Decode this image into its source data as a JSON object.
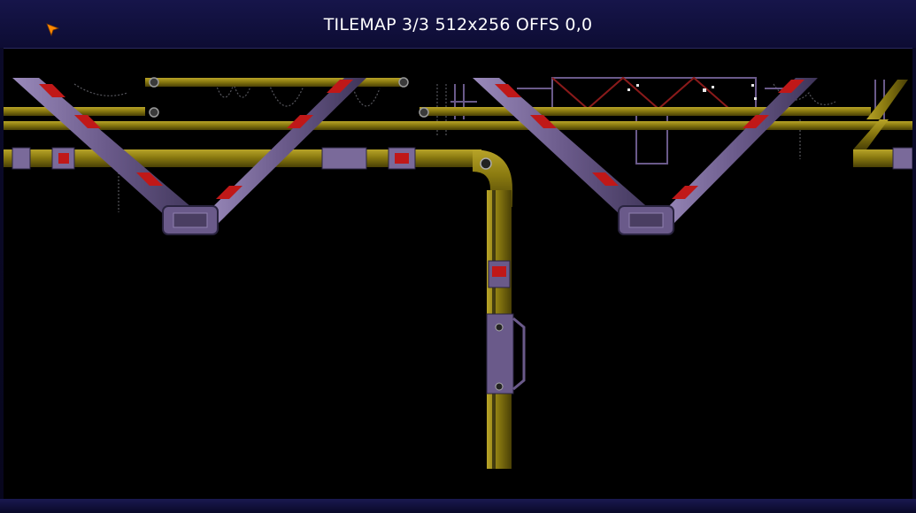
{
  "window": {
    "title": "TILEMAP 3/3 512x256 OFFS 0,0"
  },
  "cursor": {
    "icon": "arrow-cursor-icon",
    "color": "#ff8800"
  },
  "palette": {
    "pipe_yellow": "#8a7a10",
    "pipe_yellow_dark": "#5a4e08",
    "pipe_yellow_light": "#b8a428",
    "girder_purple": "#6a5a8a",
    "girder_purple_light": "#9080b0",
    "stripe_red": "#c01818",
    "stripe_white": "#e8e8e8",
    "wire_grey": "#7a7a80"
  }
}
